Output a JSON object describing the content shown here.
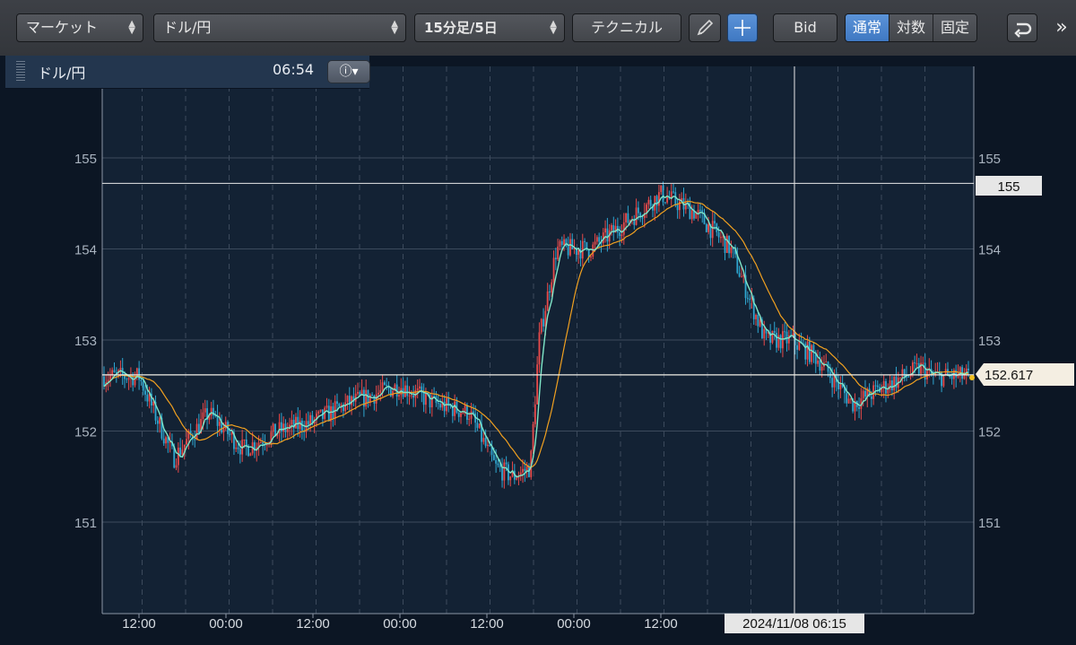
{
  "toolbar": {
    "market_label": "マーケット",
    "symbol_label": "ドル/円",
    "interval_label": "15分足/5日",
    "technical_label": "テクニカル",
    "bid_label": "Bid",
    "scale_normal": "通常",
    "scale_log": "対数",
    "scale_fixed": "固定",
    "more_label": "»"
  },
  "info_panel": {
    "symbol": "ドル/円",
    "time": "06:54"
  },
  "colors": {
    "background": "#0c1624",
    "up_candle": "#e84a4a",
    "down_candle": "#2fa6d0",
    "ma_short": "#7fe6c8",
    "ma_long": "#f0a020",
    "accent_blue": "#4a86cf"
  },
  "chart_data": {
    "type": "candlestick",
    "symbol": "ドル/円",
    "interval": "15分足/5日",
    "ylim": [
      150,
      156
    ],
    "y_ticks": [
      "151",
      "152",
      "153",
      "154",
      "155"
    ],
    "x_ticks": [
      "12:00",
      "00:00",
      "12:00",
      "00:00",
      "12:00",
      "00:00",
      "12:00",
      "00:00"
    ],
    "crosshair": {
      "date_label": "2024/11/08 06:15",
      "price_label": "155",
      "price": 154.72
    },
    "current_price": {
      "label": "152.617",
      "value": 152.617
    },
    "grid": true,
    "series": [
      {
        "name": "",
        "x_day_offset": [
          0,
          0.2,
          0.4,
          0.6,
          0.8,
          1.0,
          1.2,
          1.5,
          1.7,
          1.9,
          2.05,
          2.15,
          2.25,
          2.3,
          2.4,
          2.6,
          2.8,
          3.0,
          3.2,
          3.4,
          3.6,
          3.75,
          3.9,
          4.1,
          4.3,
          4.5,
          4.55
        ],
        "values": [
          152.6,
          151.7,
          152.2,
          151.8,
          152.0,
          152.1,
          152.3,
          152.5,
          152.3,
          152.2,
          151.6,
          151.5,
          151.6,
          153.0,
          154.0,
          154.0,
          154.3,
          154.6,
          154.4,
          154.0,
          153.0,
          153.0,
          152.8,
          152.3,
          152.5,
          152.7,
          152.6
        ]
      }
    ]
  }
}
